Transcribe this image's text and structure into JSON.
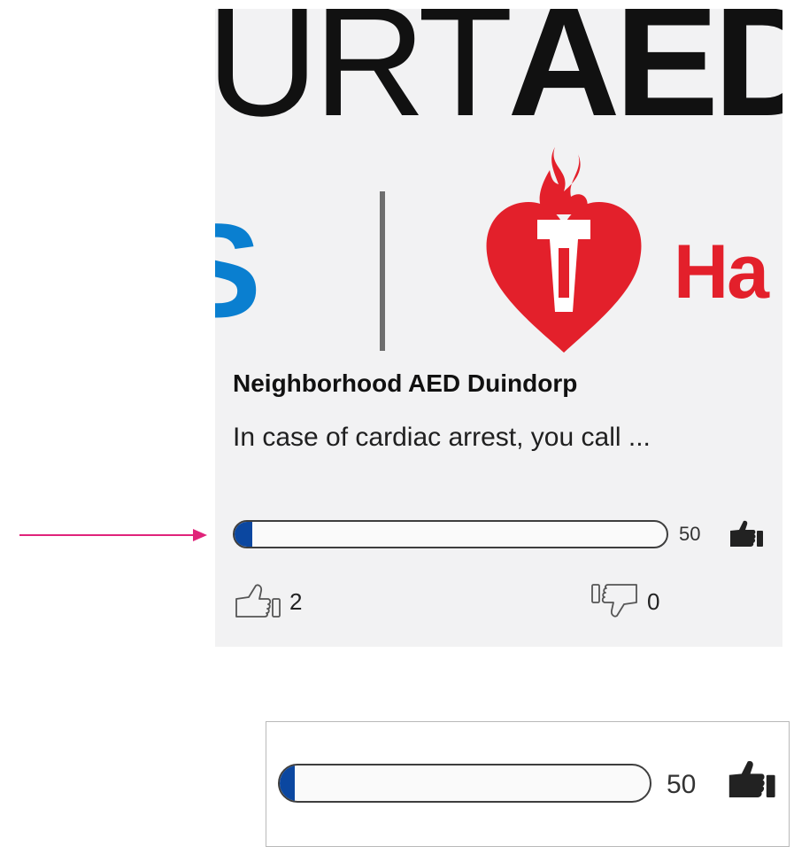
{
  "card": {
    "banner": {
      "wordmark_light": "URT",
      "wordmark_bold": "AED.",
      "partial_left_letter": "S",
      "partial_right_text": "Ha",
      "colors": {
        "wordmark": "#111111",
        "left_brand": "#0a7fd0",
        "heart": "#e3202b",
        "divider": "#6e6e6e"
      }
    },
    "title": "Neighborhood AED Duindorp",
    "description": "In case of cardiac arrest, you call ...",
    "progress": {
      "value_label": "50",
      "fill_fraction": 0.04,
      "fill_color": "#0b47a0",
      "goal_icon": "thumbs-up-filled-icon"
    },
    "votes": {
      "up_count": "2",
      "up_icon": "thumbs-up-outline-icon",
      "down_count": "0",
      "down_icon": "thumbs-down-outline-icon"
    }
  },
  "callout": {
    "arrow_color": "#e0237a"
  },
  "zoom": {
    "value_label": "50",
    "fill_fraction": 0.04
  }
}
